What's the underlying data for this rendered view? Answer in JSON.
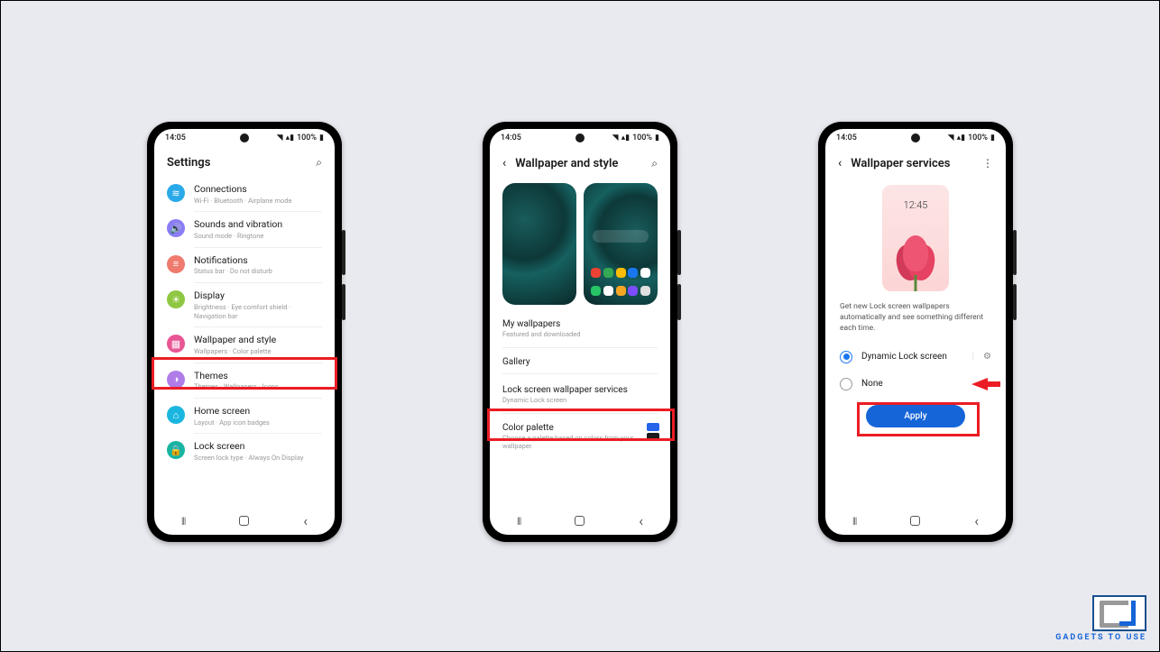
{
  "status": {
    "time": "14:05",
    "battery": "100%"
  },
  "phone1": {
    "title": "Settings",
    "items": [
      {
        "icon_bg": "#2aa9e8",
        "glyph": "≋",
        "title": "Connections",
        "sub": "Wi-Fi · Bluetooth · Airplane mode"
      },
      {
        "icon_bg": "#8a7df5",
        "glyph": "🔊",
        "title": "Sounds and vibration",
        "sub": "Sound mode · Ringtone"
      },
      {
        "icon_bg": "#ef7a6e",
        "glyph": "≡",
        "title": "Notifications",
        "sub": "Status bar · Do not disturb"
      },
      {
        "icon_bg": "#8fc742",
        "glyph": "☀",
        "title": "Display",
        "sub": "Brightness · Eye comfort shield · Navigation bar"
      },
      {
        "icon_bg": "#e85594",
        "glyph": "▦",
        "title": "Wallpaper and style",
        "sub": "Wallpapers · Color palette"
      },
      {
        "icon_bg": "#b07de8",
        "glyph": "◑",
        "title": "Themes",
        "sub": "Themes · Wallpapers · Icons"
      },
      {
        "icon_bg": "#1bb6e0",
        "glyph": "⌂",
        "title": "Home screen",
        "sub": "Layout · App icon badges"
      },
      {
        "icon_bg": "#19b4a2",
        "glyph": "🔒",
        "title": "Lock screen",
        "sub": "Screen lock type · Always On Display"
      }
    ]
  },
  "phone2": {
    "title": "Wallpaper and style",
    "my_wallpapers": "My wallpapers",
    "my_wallpapers_sub": "Featured and downloaded",
    "gallery": "Gallery",
    "lock_services": "Lock screen wallpaper services",
    "lock_services_sub": "Dynamic Lock screen",
    "color_palette": "Color palette",
    "color_palette_sub": "Choose a palette based on colors from your wallpaper.",
    "swatches": [
      "#2563eb",
      "#1a1a1a"
    ]
  },
  "phone3": {
    "title": "Wallpaper services",
    "preview_clock": "12:45",
    "desc": "Get new Lock screen wallpapers automatically and see something different each time.",
    "opt_dynamic": "Dynamic Lock screen",
    "opt_none": "None",
    "apply": "Apply"
  },
  "watermark": "GADGETS TO USE"
}
